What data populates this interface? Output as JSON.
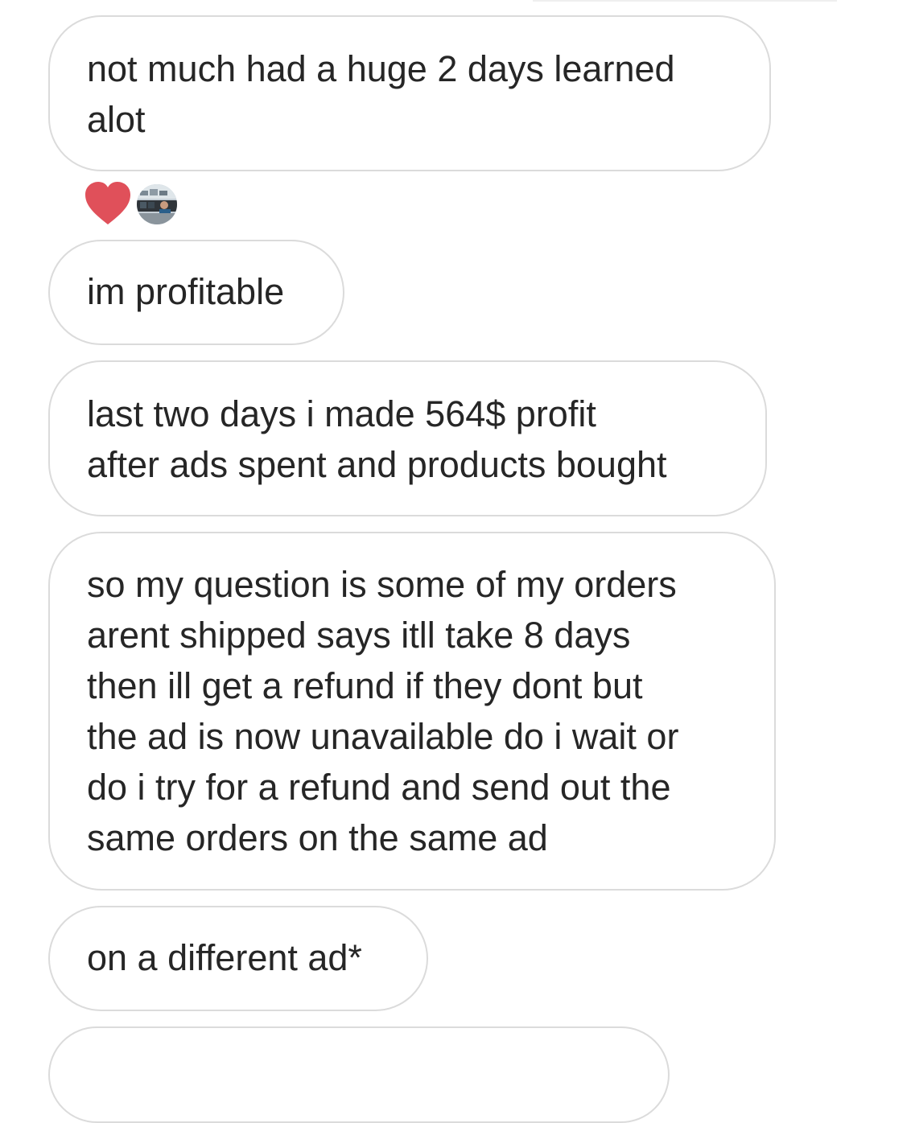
{
  "messages": [
    {
      "text": "not much had a huge 2 days learned\nalot"
    },
    {
      "text": "im profitable"
    },
    {
      "text": "last two days i made 564$ profit\nafter ads spent and products bought"
    },
    {
      "text": "so my question is some of my orders\narent shipped says itll take 8 days\nthen ill get a refund if they dont but\nthe ad is now unavailable do i wait or\ndo i try for a refund and send out the\nsame orders on the same ad"
    },
    {
      "text": "on a different ad*"
    }
  ],
  "reactions": {
    "icon": "heart-icon",
    "color": "#e0505a"
  },
  "colors": {
    "bubble_border": "#dbdbdb",
    "text": "#262626",
    "background": "#ffffff"
  }
}
